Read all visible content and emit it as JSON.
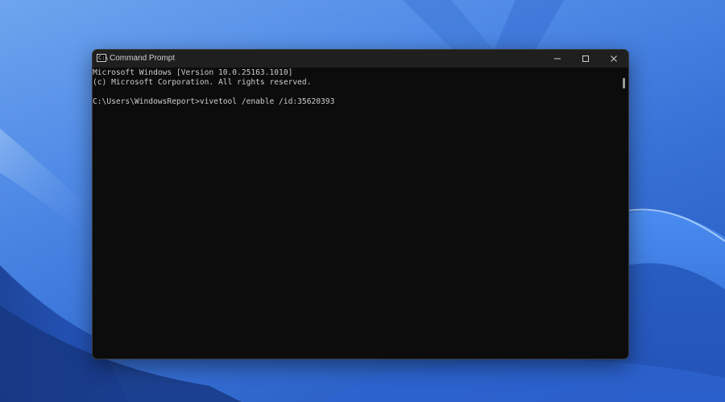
{
  "window": {
    "title": "Command Prompt",
    "controls": {
      "minimize_icon": "minimize-icon",
      "maximize_icon": "maximize-icon",
      "close_icon": "close-icon"
    }
  },
  "console": {
    "lines": [
      "Microsoft Windows [Version 10.0.25163.1010]",
      "(c) Microsoft Corporation. All rights reserved.",
      "",
      "C:\\Users\\WindowsReport>vivetool /enable /id:35620393"
    ]
  },
  "colors": {
    "console_bg": "#0c0c0c",
    "console_text": "#cccccc",
    "titlebar_bg": "#1f1f1f",
    "wallpaper_accent": "#2f66cc"
  }
}
